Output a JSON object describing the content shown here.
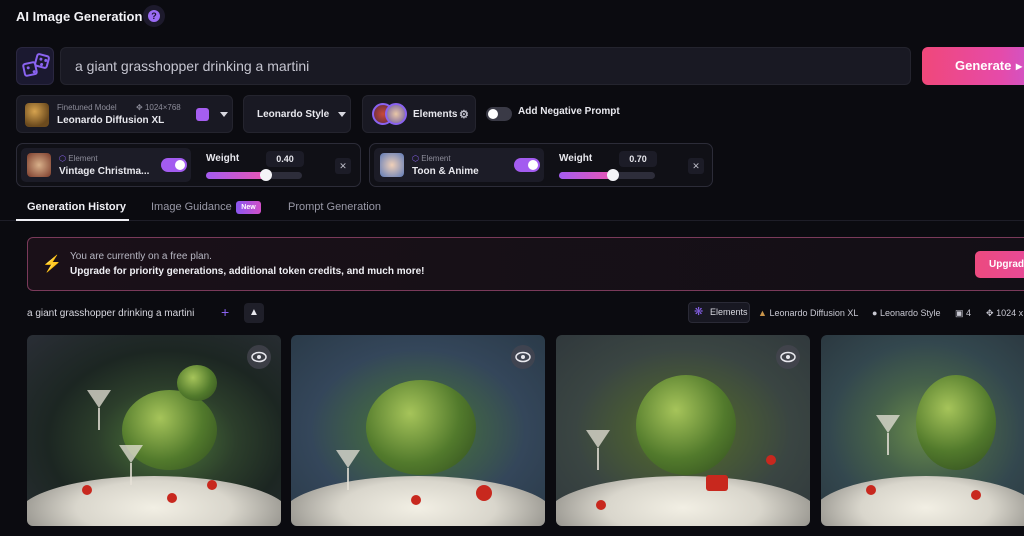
{
  "app": {
    "title": "AI Image Generation"
  },
  "prompt": {
    "value": "a giant grasshopper drinking a martini"
  },
  "generate": {
    "label": "Generate"
  },
  "model": {
    "caption": "Finetuned Model",
    "dimensions": "1024×768",
    "name": "Leonardo Diffusion XL"
  },
  "style": {
    "label": "Leonardo Style"
  },
  "elements_button": {
    "label": "Elements"
  },
  "negative_prompt": {
    "label": "Add Negative Prompt",
    "enabled": false
  },
  "elements": [
    {
      "tag": "Element",
      "name": "Vintage Christma...",
      "weight_label": "Weight",
      "weight": "0.40",
      "weight_value": 0.4,
      "enabled": true
    },
    {
      "tag": "Element",
      "name": "Toon & Anime",
      "weight_label": "Weight",
      "weight": "0.70",
      "weight_value": 0.7,
      "enabled": true
    }
  ],
  "tabs": [
    {
      "label": "Generation History",
      "active": true
    },
    {
      "label": "Image Guidance",
      "badge": "New"
    },
    {
      "label": "Prompt Generation"
    }
  ],
  "banner": {
    "line1": "You are currently on a free plan.",
    "line2": "Upgrade for priority generations, additional token credits, and much more!",
    "button": "Upgrade"
  },
  "history": {
    "prompt": "a giant grasshopper drinking a martini",
    "meta": {
      "elements": "Elements",
      "model": "Leonardo Diffusion XL",
      "style": "Leonardo Style",
      "count": "4",
      "size": "1024 x"
    },
    "images": [
      {
        "alt": "grasshopper image 1"
      },
      {
        "alt": "grasshopper image 2"
      },
      {
        "alt": "grasshopper image 3"
      },
      {
        "alt": "grasshopper image 4"
      }
    ]
  },
  "colors": {
    "accent": "#a35cf0",
    "generate": "#f0487a",
    "banner_border": "#7a3a5a"
  }
}
